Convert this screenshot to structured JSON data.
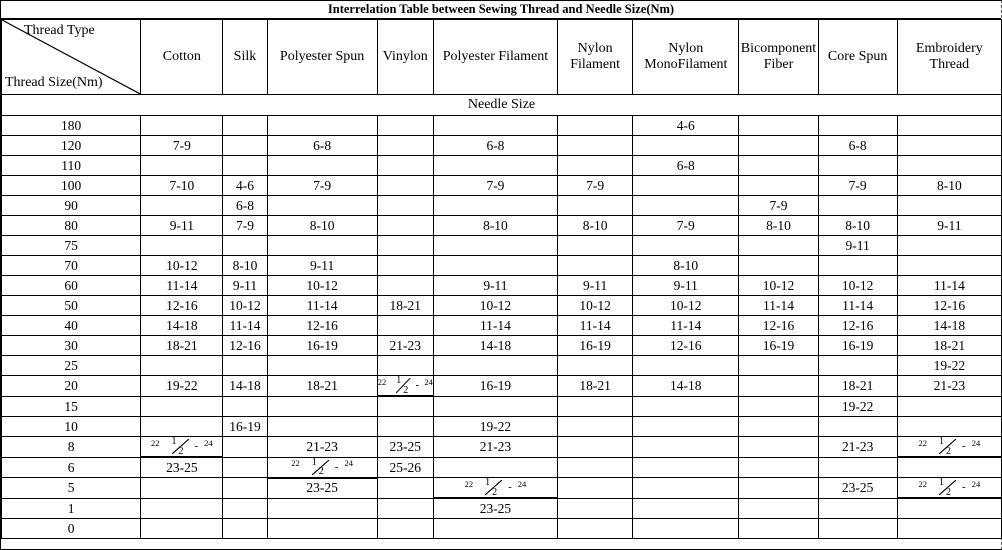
{
  "title": "Interrelation Table between Sewing Thread and Needle Size(Nm)",
  "corner": {
    "top_label": "Thread Type",
    "bottom_label": "Thread Size(Nm)"
  },
  "needle_size_band": "Needle Size",
  "columns": [
    "Cotton",
    "Silk",
    "Polyester Spun",
    "Vinylon",
    "Polyester Filament",
    "Nylon Filament",
    "Nylon MonoFilament",
    "Bicomponent Fiber",
    "Core Spun",
    "Embroidery Thread"
  ],
  "fraction_text": "22 1/2 - 24",
  "fraction_parts": {
    "whole": "22",
    "numerator": "1",
    "denominator": "2",
    "dash": "-",
    "end": "24"
  },
  "rows": [
    {
      "size": "180",
      "values": [
        "",
        "",
        "",
        "",
        "",
        "",
        "4-6",
        "",
        "",
        ""
      ]
    },
    {
      "size": "120",
      "values": [
        "7-9",
        "",
        "6-8",
        "",
        "6-8",
        "",
        "",
        "",
        "6-8",
        ""
      ]
    },
    {
      "size": "110",
      "values": [
        "",
        "",
        "",
        "",
        "",
        "",
        "6-8",
        "",
        "",
        ""
      ]
    },
    {
      "size": "100",
      "values": [
        "7-10",
        "4-6",
        "7-9",
        "",
        "7-9",
        "7-9",
        "",
        "",
        "7-9",
        "8-10"
      ]
    },
    {
      "size": "90",
      "values": [
        "",
        "6-8",
        "",
        "",
        "",
        "",
        "",
        "7-9",
        "",
        ""
      ]
    },
    {
      "size": "80",
      "values": [
        "9-11",
        "7-9",
        "8-10",
        "",
        "8-10",
        "8-10",
        "7-9",
        "8-10",
        "8-10",
        "9-11"
      ]
    },
    {
      "size": "75",
      "values": [
        "",
        "",
        "",
        "",
        "",
        "",
        "",
        "",
        "9-11",
        ""
      ]
    },
    {
      "size": "70",
      "values": [
        "10-12",
        "8-10",
        "9-11",
        "",
        "",
        "",
        "8-10",
        "",
        "",
        ""
      ]
    },
    {
      "size": "60",
      "values": [
        "11-14",
        "9-11",
        "10-12",
        "",
        "9-11",
        "9-11",
        "9-11",
        "10-12",
        "10-12",
        "11-14"
      ]
    },
    {
      "size": "50",
      "values": [
        "12-16",
        "10-12",
        "11-14",
        "18-21",
        "10-12",
        "10-12",
        "10-12",
        "11-14",
        "11-14",
        "12-16"
      ]
    },
    {
      "size": "40",
      "values": [
        "14-18",
        "11-14",
        "12-16",
        "",
        "11-14",
        "11-14",
        "11-14",
        "12-16",
        "12-16",
        "14-18"
      ]
    },
    {
      "size": "30",
      "values": [
        "18-21",
        "12-16",
        "16-19",
        "21-23",
        "14-18",
        "16-19",
        "12-16",
        "16-19",
        "16-19",
        "18-21"
      ]
    },
    {
      "size": "25",
      "values": [
        "",
        "",
        "",
        "",
        "",
        "",
        "",
        "",
        "",
        "19-22"
      ]
    },
    {
      "size": "20",
      "values": [
        "19-22",
        "14-18",
        "18-21",
        "FRACTION",
        "16-19",
        "18-21",
        "14-18",
        "",
        "18-21",
        "21-23"
      ]
    },
    {
      "size": "15",
      "values": [
        "",
        "",
        "",
        "",
        "",
        "",
        "",
        "",
        "19-22",
        ""
      ]
    },
    {
      "size": "10",
      "values": [
        "",
        "16-19",
        "",
        "",
        "19-22",
        "",
        "",
        "",
        "",
        ""
      ]
    },
    {
      "size": "8",
      "values": [
        "FRACTION",
        "",
        "21-23",
        "23-25",
        "21-23",
        "",
        "",
        "",
        "21-23",
        "FRACTION"
      ]
    },
    {
      "size": "6",
      "values": [
        "23-25",
        "",
        "FRACTION",
        "25-26",
        "",
        "",
        "",
        "",
        "",
        ""
      ]
    },
    {
      "size": "5",
      "values": [
        "",
        "",
        "23-25",
        "",
        "FRACTION",
        "",
        "",
        "",
        "23-25",
        "FRACTION"
      ]
    },
    {
      "size": "1",
      "values": [
        "",
        "",
        "",
        "",
        "23-25",
        "",
        "",
        "",
        "",
        ""
      ]
    },
    {
      "size": "0",
      "values": [
        "",
        "",
        "",
        "",
        "",
        "",
        "",
        "",
        "",
        ""
      ]
    }
  ]
}
